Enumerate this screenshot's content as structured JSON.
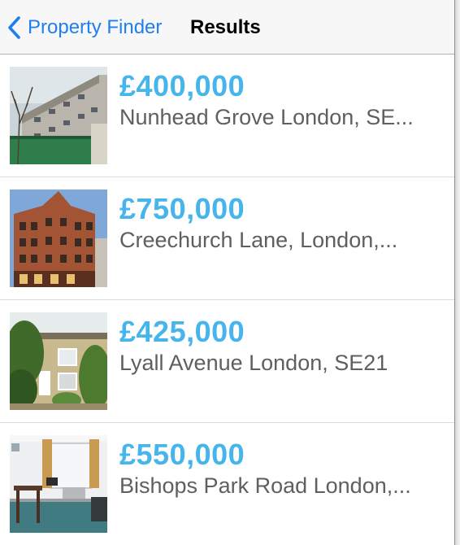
{
  "nav": {
    "back_label": "Property Finder",
    "title": "Results",
    "accent_color": "#1f7ef0"
  },
  "price_color": "#45b5ec",
  "listings": [
    {
      "price": "£400,000",
      "address": "Nunhead Grove London, SE..."
    },
    {
      "price": "£750,000",
      "address": "Creechurch Lane, London,..."
    },
    {
      "price": "£425,000",
      "address": "Lyall Avenue London, SE21"
    },
    {
      "price": "£550,000",
      "address": "Bishops Park Road London,..."
    }
  ]
}
